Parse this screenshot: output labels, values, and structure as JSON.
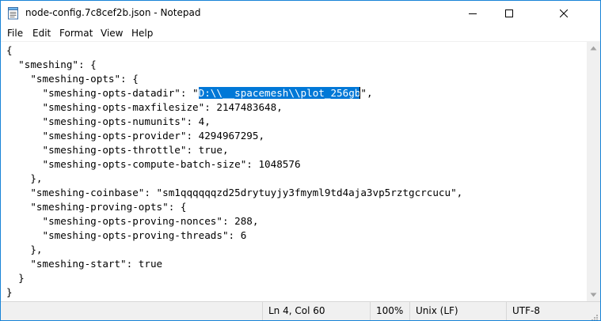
{
  "window": {
    "title": "node-config.7c8cef2b.json - Notepad",
    "colors": {
      "border": "#1883d7",
      "selection": "#0078d7",
      "chrome": "#f0f0f0"
    }
  },
  "menu": {
    "file": "File",
    "edit": "Edit",
    "format": "Format",
    "view": "View",
    "help": "Help"
  },
  "editor": {
    "lines": [
      "{",
      "  \"smeshing\": {",
      "    \"smeshing-opts\": {",
      {
        "before": "      \"smeshing-opts-datadir\": \"",
        "selected": "D:\\\\__spacemesh\\\\plot_256gb",
        "after": "\","
      },
      "      \"smeshing-opts-maxfilesize\": 2147483648,",
      "      \"smeshing-opts-numunits\": 4,",
      "      \"smeshing-opts-provider\": 4294967295,",
      "      \"smeshing-opts-throttle\": true,",
      "      \"smeshing-opts-compute-batch-size\": 1048576",
      "    },",
      "    \"smeshing-coinbase\": \"sm1qqqqqqzd25drytuyjy3fmyml9td4aja3vp5rztgcrcucu\",",
      "    \"smeshing-proving-opts\": {",
      "      \"smeshing-opts-proving-nonces\": 288,",
      "      \"smeshing-opts-proving-threads\": 6",
      "    },",
      "    \"smeshing-start\": true",
      "  }",
      "}"
    ]
  },
  "status": {
    "position": "Ln 4, Col 60",
    "zoom": "100%",
    "line_ending": "Unix (LF)",
    "encoding": "UTF-8"
  }
}
